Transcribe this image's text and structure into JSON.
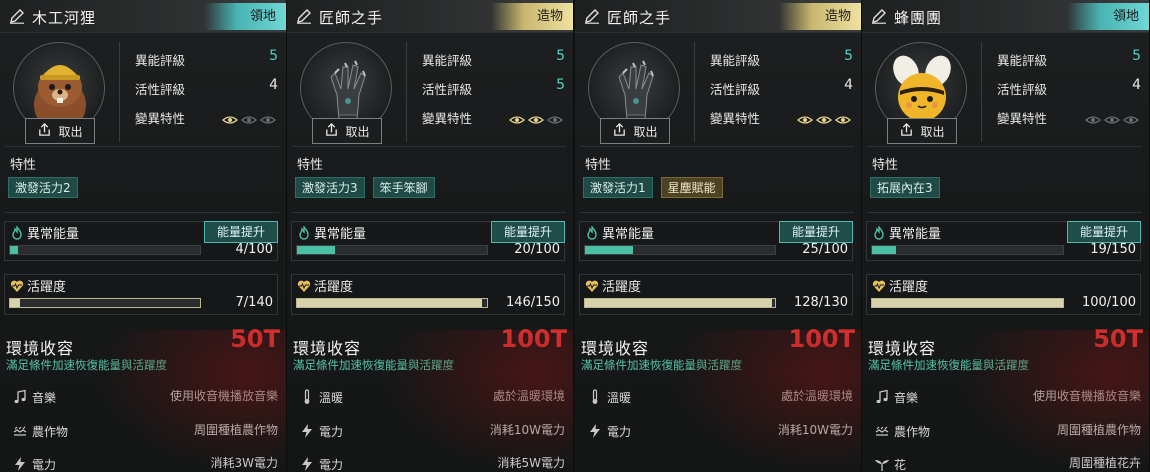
{
  "cards": [
    {
      "name": "木工河狸",
      "category": "領地",
      "category_style": "teal",
      "portrait": "beaver-with-hardhat",
      "fetch_label": "取出",
      "stats": {
        "psionic_label": "異能評級",
        "psionic_value": "5",
        "psionic_color": "#4fd1c5",
        "activity_label": "活性評級",
        "activity_value": "4",
        "activity_color": "#e6e6e6",
        "mutation_label": "變異特性",
        "mutation_level": 1
      },
      "traits_label": "特性",
      "traits": [
        {
          "label": "激發活力2",
          "style": "teal"
        }
      ],
      "energy": {
        "label": "異常能量",
        "boost_label": "能量提升",
        "current": 4,
        "max": 100,
        "text": "4/100"
      },
      "activity": {
        "label": "活躍度",
        "current": 7,
        "max": 140,
        "text": "7/140"
      },
      "env": {
        "title": "環境收容",
        "cost": "50T",
        "note": "滿足條件加速恢復能量與活躍度"
      },
      "conditions": [
        {
          "icon": "music-note-icon",
          "name": "音樂",
          "desc": "使用收音機播放音樂"
        },
        {
          "icon": "crops-icon",
          "name": "農作物",
          "desc": "周圍種植農作物"
        },
        {
          "icon": "lightning-icon",
          "name": "電力",
          "desc": "消耗3W電力"
        }
      ]
    },
    {
      "name": "匠師之手",
      "category": "造物",
      "category_style": "gold",
      "portrait": "mechanical-claw-hand",
      "fetch_label": "取出",
      "stats": {
        "psionic_label": "異能評級",
        "psionic_value": "5",
        "psionic_color": "#4fd1c5",
        "activity_label": "活性評級",
        "activity_value": "5",
        "activity_color": "#4fd1c5",
        "mutation_label": "變異特性",
        "mutation_level": 2
      },
      "traits_label": "特性",
      "traits": [
        {
          "label": "激發活力3",
          "style": "teal"
        },
        {
          "label": "笨手笨腳",
          "style": "teal"
        }
      ],
      "energy": {
        "label": "異常能量",
        "boost_label": "能量提升",
        "current": 20,
        "max": 100,
        "text": "20/100"
      },
      "activity": {
        "label": "活躍度",
        "current": 146,
        "max": 150,
        "text": "146/150"
      },
      "env": {
        "title": "環境收容",
        "cost": "100T",
        "note": "滿足條件加速恢復能量與活躍度"
      },
      "conditions": [
        {
          "icon": "thermometer-icon",
          "name": "溫暖",
          "desc": "處於溫暖環境"
        },
        {
          "icon": "lightning-icon",
          "name": "電力",
          "desc": "消耗10W電力"
        },
        {
          "icon": "lightning-icon",
          "name": "電力",
          "desc": "消耗5W電力"
        }
      ]
    },
    {
      "name": "匠師之手",
      "category": "造物",
      "category_style": "gold",
      "portrait": "mechanical-claw-hand",
      "fetch_label": "取出",
      "stats": {
        "psionic_label": "異能評級",
        "psionic_value": "5",
        "psionic_color": "#4fd1c5",
        "activity_label": "活性評級",
        "activity_value": "4",
        "activity_color": "#e6e6e6",
        "mutation_label": "變異特性",
        "mutation_level": 3
      },
      "traits_label": "特性",
      "traits": [
        {
          "label": "激發活力1",
          "style": "teal"
        },
        {
          "label": "星塵賦能",
          "style": "gold"
        }
      ],
      "energy": {
        "label": "異常能量",
        "boost_label": "能量提升",
        "current": 25,
        "max": 100,
        "text": "25/100"
      },
      "activity": {
        "label": "活躍度",
        "current": 128,
        "max": 130,
        "text": "128/130"
      },
      "env": {
        "title": "環境收容",
        "cost": "100T",
        "note": "滿足條件加速恢復能量與活躍度"
      },
      "conditions": [
        {
          "icon": "thermometer-icon",
          "name": "溫暖",
          "desc": "處於溫暖環境"
        },
        {
          "icon": "lightning-icon",
          "name": "電力",
          "desc": "消耗10W電力"
        }
      ]
    },
    {
      "name": "蜂團團",
      "category": "領地",
      "category_style": "teal",
      "portrait": "round-bee",
      "fetch_label": "取出",
      "stats": {
        "psionic_label": "異能評級",
        "psionic_value": "5",
        "psionic_color": "#4fd1c5",
        "activity_label": "活性評級",
        "activity_value": "4",
        "activity_color": "#e6e6e6",
        "mutation_label": "變異特性",
        "mutation_level": 0
      },
      "traits_label": "特性",
      "traits": [
        {
          "label": "拓展內在3",
          "style": "teal"
        }
      ],
      "energy": {
        "label": "異常能量",
        "boost_label": "能量提升",
        "current": 19,
        "max": 150,
        "text": "19/150"
      },
      "activity": {
        "label": "活躍度",
        "current": 100,
        "max": 100,
        "text": "100/100"
      },
      "env": {
        "title": "環境收容",
        "cost": "50T",
        "note": "滿足條件加速恢復能量與活躍度"
      },
      "conditions": [
        {
          "icon": "music-note-icon",
          "name": "音樂",
          "desc": "使用收音機播放音樂"
        },
        {
          "icon": "crops-icon",
          "name": "農作物",
          "desc": "周圍種植農作物"
        },
        {
          "icon": "flower-icon",
          "name": "花",
          "desc": "周圍種植花卉"
        }
      ]
    }
  ]
}
